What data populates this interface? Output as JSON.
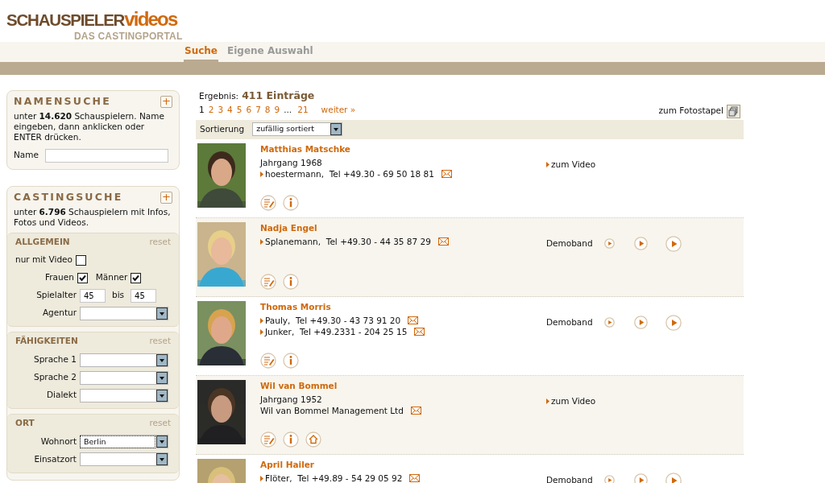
{
  "logo": {
    "main": "SCHAUSPIELER",
    "accent": "videos",
    "tagline": "DAS CASTINGPORTAL"
  },
  "tabs": [
    {
      "label": "Suche",
      "selected": true
    },
    {
      "label": "Eigene Auswahl",
      "selected": false
    }
  ],
  "name_search": {
    "title": "NAMENSUCHE",
    "toggle": "+",
    "intro": "unter **14.620** Schauspielern. Name eingeben, dann anklicken oder ENTER drücken.",
    "label": "Name"
  },
  "casting_search": {
    "title": "CASTINGSUCHE",
    "toggle": "+",
    "intro": "unter **6.796** Schauspielern mit Infos, Fotos und Videos.",
    "sections": [
      {
        "title": "ALLGEMEIN",
        "reset": "reset",
        "fields": [
          {
            "kind": "checkbox",
            "label": "nur mit Video",
            "checked": false
          },
          {
            "kind": "checkpair",
            "items": [
              {
                "label": "Frauen",
                "checked": true
              },
              {
                "label": "Männer",
                "checked": true
              }
            ]
          },
          {
            "kind": "range",
            "label": "Spielalter",
            "from": "45",
            "separator": "bis",
            "to": "45"
          },
          {
            "kind": "select",
            "label": "Agentur"
          }
        ]
      },
      {
        "title": "FÄHIGKEITEN",
        "reset": "reset",
        "fields": [
          {
            "kind": "select",
            "label": "Sprache 1"
          },
          {
            "kind": "select",
            "label": "Sprache 2"
          },
          {
            "kind": "select",
            "label": "Dialekt"
          }
        ]
      },
      {
        "title": "ORT",
        "reset": "reset",
        "fields": [
          {
            "kind": "select",
            "label": "Wohnort",
            "value": "Berlin"
          },
          {
            "kind": "select",
            "label": "Einsatzort"
          }
        ]
      }
    ]
  },
  "results": {
    "label": "Ergebnis:",
    "count": "411 Einträge",
    "pages": [
      {
        "label": "1",
        "selected": true
      },
      {
        "label": "2",
        "selected": false
      },
      {
        "label": "3",
        "selected": false
      },
      {
        "label": "4",
        "selected": false
      },
      {
        "label": "5",
        "selected": false
      },
      {
        "label": "6",
        "selected": false
      },
      {
        "label": "7",
        "selected": false
      },
      {
        "label": "8",
        "selected": false
      },
      {
        "label": "9",
        "selected": false
      }
    ],
    "ellipsis": "...",
    "last_page": "21",
    "next": "weiter »",
    "photo_stack": "zum Fotostapel",
    "sort_label": "Sortierung",
    "sort_value": "zufällig sortiert"
  },
  "people": [
    {
      "name": "Matthias Matschke",
      "lines": [
        {
          "text": "Jahrgang 1968",
          "arrow": false,
          "mail": false
        },
        {
          "text": "hoestermann,  Tel +49.30 - 69 50 18 81",
          "arrow": true,
          "mail": true
        }
      ],
      "video": {
        "kind": "link",
        "label": "zum Video"
      },
      "home": false
    },
    {
      "name": "Nadja Engel",
      "lines": [
        {
          "text": "Splanemann,  Tel +49.30 - 44 35 87 29",
          "arrow": true,
          "mail": true
        }
      ],
      "video": {
        "kind": "demoband",
        "label": "Demoband"
      },
      "home": false
    },
    {
      "name": "Thomas Morris",
      "lines": [
        {
          "text": "Pauly,  Tel +49.30 - 43 73 91 20",
          "arrow": true,
          "mail": true
        },
        {
          "text": "Junker,  Tel +49.2331 - 204 25 15",
          "arrow": true,
          "mail": true
        }
      ],
      "video": {
        "kind": "demoband",
        "label": "Demoband"
      },
      "home": false
    },
    {
      "name": "Wil van Bommel",
      "lines": [
        {
          "text": "Jahrgang 1952",
          "arrow": false,
          "mail": false
        },
        {
          "text": "Wil van Bommel Management Ltd",
          "arrow": false,
          "mail": true
        }
      ],
      "video": {
        "kind": "link",
        "label": "zum Video"
      },
      "home": true
    },
    {
      "name": "April Hailer",
      "lines": [
        {
          "text": "Flöter,  Tel +49.89 - 54 29 05 92",
          "arrow": true,
          "mail": true
        }
      ],
      "video": {
        "kind": "demoband",
        "label": "Demoband"
      }
    }
  ]
}
